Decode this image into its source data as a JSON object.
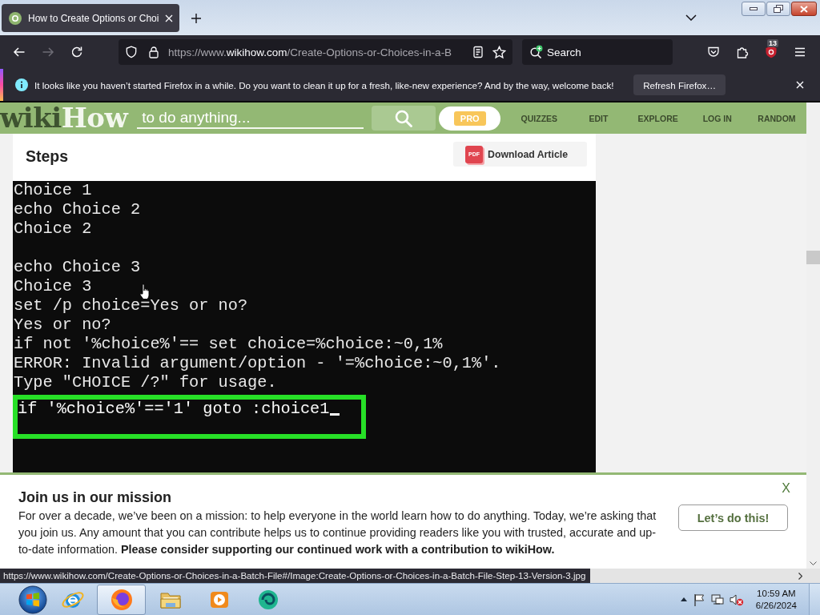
{
  "browser": {
    "tab": {
      "title": "How to Create Options or Choi",
      "selected": true
    },
    "nav_buttons": [
      {
        "kind": "back",
        "disabled": false
      },
      {
        "kind": "forward",
        "disabled": true
      },
      {
        "kind": "reload",
        "disabled": false
      }
    ],
    "url_parts": [
      {
        "text": "https://www.",
        "highlighted": false
      },
      {
        "text": "wikihow.com",
        "highlighted": true
      },
      {
        "text": "/Create-Options-or-Choices-in-a-B",
        "highlighted": false
      }
    ],
    "search": {
      "placeholder": "Search"
    },
    "extension_badge": "13",
    "notification": {
      "message": "It looks like you haven’t started Firefox in a while. Do you want to clean it up for a fresh, like-new experience? And by the way, welcome back!",
      "button": "Refresh Firefox…"
    }
  },
  "page": {
    "header": {
      "logo_parts": [
        "wiki",
        "How"
      ],
      "search_placeholder": "to do anything...",
      "pro_badge": "PRO",
      "nav": [
        "QUIZZES",
        "EDIT",
        "EXPLORE",
        "LOG IN",
        "RANDOM"
      ]
    },
    "section_title": "Steps",
    "download": {
      "icon_label": "PDF",
      "label": "Download Article"
    },
    "terminal": {
      "blocks": [
        [
          "Choice 1",
          "echo Choice 2",
          "Choice 2"
        ],
        [
          "echo Choice 3",
          "Choice 3",
          "set /p choice=Yes or no?",
          "Yes or no?",
          "if not '%choice%'== set choice=%choice:~0,1%",
          "ERROR: Invalid argument/option - '=%choice:~0,1%'.",
          "Type \"CHOICE /?\" for usage."
        ]
      ],
      "highlight": {
        "text": "if '%choice%'=='1' goto :choice1",
        "cursor": true
      }
    },
    "banner": {
      "title": "Join us in our mission",
      "text": "For over a decade, we’ve been on a mission: to help everyone in the world learn how to do anything. Today, we’re asking that you join us. Any amount that you can contribute helps us to continue providing readers like you with trusted, accurate and up-to-date information. **Please consider supporting our continued work with a contribution to wikiHow.**",
      "button": "Let’s do this!",
      "close": "X"
    },
    "status_url": "https://www.wikihow.com/Create-Options-or-Choices-in-a-Batch-File#/Image:Create-Options-or-Choices-in-a-Batch-File-Step-13-Version-3.jpg"
  },
  "taskbar": {
    "apps": [
      {
        "kind": "ie",
        "selected": false
      },
      {
        "kind": "firefox",
        "selected": true
      },
      {
        "kind": "folder",
        "selected": false
      },
      {
        "kind": "player",
        "selected": false
      },
      {
        "kind": "orb",
        "selected": false
      }
    ],
    "clock": {
      "time": "10:59 AM",
      "date": "6/26/2024"
    }
  }
}
